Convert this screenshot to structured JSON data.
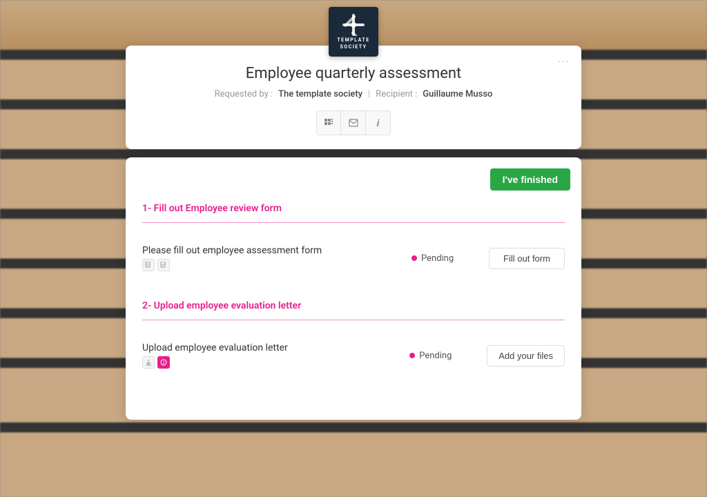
{
  "logo": {
    "line1": "TEMPLATE",
    "line2": "SOCIETY"
  },
  "header": {
    "title": "Employee quarterly assessment",
    "requested_label": "Requested by :",
    "requested_value": "The template society",
    "separator": "|",
    "recipient_label": "Recipient :",
    "recipient_value": "Guillaume Musso",
    "dots": "···",
    "icons": [
      {
        "name": "grid-icon",
        "symbol": "⊞"
      },
      {
        "name": "mail-icon",
        "symbol": "✉"
      },
      {
        "name": "info-icon",
        "symbol": "i"
      }
    ]
  },
  "main": {
    "finished_button": "I've finished",
    "sections": [
      {
        "number": "1",
        "title": "Fill out Employee review form",
        "tasks": [
          {
            "name": "Please fill out employee assessment form",
            "has_icon": true,
            "icon_type": "default",
            "status": "Pending",
            "action_label": "Fill out form"
          }
        ]
      },
      {
        "number": "2",
        "title": "Upload employee evaluation letter",
        "tasks": [
          {
            "name": "Upload employee evaluation letter",
            "has_icon": true,
            "icon_type": "pink",
            "status": "Pending",
            "action_label": "Add your files"
          }
        ]
      }
    ]
  },
  "colors": {
    "accent_pink": "#e91e8c",
    "accent_green": "#28a745",
    "logo_bg": "#1a2a3a"
  }
}
